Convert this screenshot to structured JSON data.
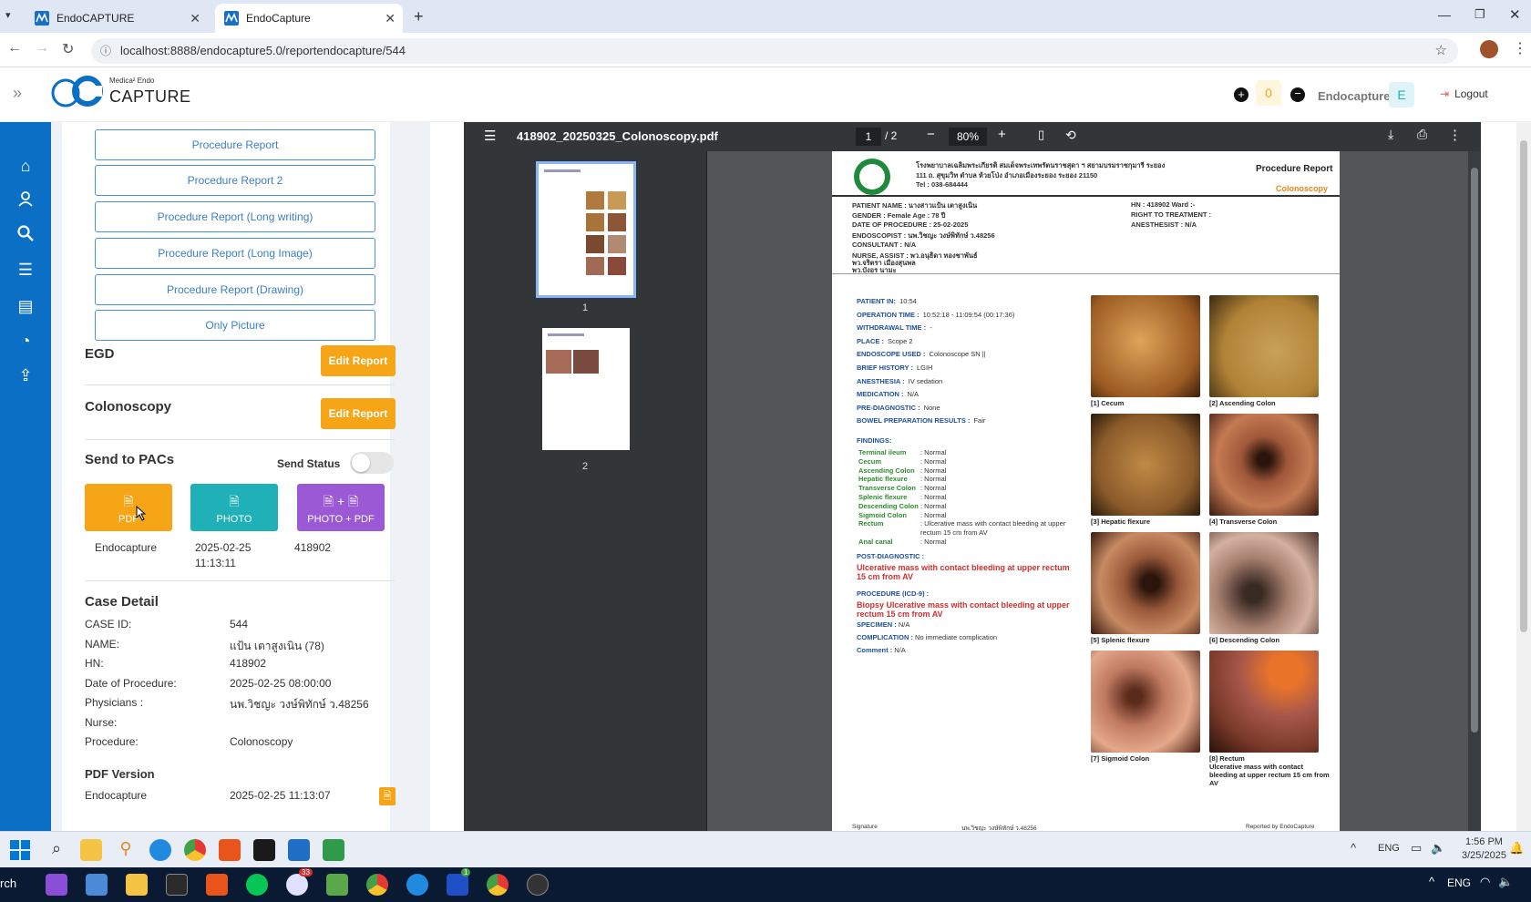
{
  "browser": {
    "tabs": [
      {
        "title": "EndoCAPTURE",
        "active": false
      },
      {
        "title": "EndoCapture",
        "active": true
      }
    ],
    "url": "localhost:8888/endocapture5.0/reportendocapture/544"
  },
  "header": {
    "logo_small": "Medica² Endo",
    "logo_big": "CAPTURE",
    "counter": "0",
    "username": "Endocapture",
    "avatar_letter": "E",
    "logout_label": "Logout"
  },
  "left": {
    "report_buttons": [
      "Procedure Report",
      "Procedure Report 2",
      "Procedure Report (Long writing)",
      "Procedure Report (Long Image)",
      "Procedure Report (Drawing)",
      "Only Picture"
    ],
    "egd_title": "EGD",
    "colonoscopy_title": "Colonoscopy",
    "edit_report_label": "Edit Report",
    "pacs_title": "Send to PACs",
    "send_status_label": "Send Status",
    "pacs_buttons": {
      "pdf": "PDF",
      "photo": "PHOTO",
      "photo_pdf": "PHOTO + PDF"
    },
    "pacs_row": {
      "user": "Endocapture",
      "date": "2025-02-25",
      "time": "11:13:11",
      "hn": "418902"
    },
    "case_title": "Case Detail",
    "case": [
      {
        "k": "CASE ID:",
        "v": "544"
      },
      {
        "k": "NAME:",
        "v": "แป้น เตาสูงเนิน (78)"
      },
      {
        "k": "HN:",
        "v": "418902"
      },
      {
        "k": "Date of Procedure:",
        "v": "2025-02-25 08:00:00"
      },
      {
        "k": "Physicians :",
        "v": "นพ.วิชญะ วงษ์พิทักษ์ ว.48256"
      },
      {
        "k": "Nurse:",
        "v": ""
      },
      {
        "k": "Procedure:",
        "v": "Colonoscopy"
      }
    ],
    "pdf_version_title": "PDF Version",
    "pdf_version_user": "Endocapture",
    "pdf_version_date": "2025-02-25 11:13:07"
  },
  "pdf": {
    "filename": "418902_20250325_Colonoscopy.pdf",
    "page_current": "1",
    "page_total": "/ 2",
    "zoom": "80%",
    "thumb_labels": [
      "1",
      "2"
    ],
    "report": {
      "hospital_line1": "โรงพยาบาลเฉลิมพระเกียรติ สมเด็จพระเทพรัตนราชสุดา ฯ สยามบรมราชกุมารี ระยอง",
      "hospital_line2": "111 ถ. สุขุมวิท ตำบล ห้วยโป่ง อำเภอเมืองระยอง ระยอง 21150",
      "hospital_line3": "Tel : 038-684444",
      "report_title": "Procedure Report",
      "report_subtitle": "Colonoscopy",
      "patient_name": "PATIENT NAME : นางสาวแป้น เตาสูงเนิน",
      "gender": "GENDER : Female    Age : 78  ปี",
      "date_of_procedure": "DATE OF PROCEDURE : 25-02-2025",
      "endoscopist": "ENDOSCOPIST :  นพ.วิชญะ วงษ์พิทักษ์ ว.48256",
      "consultant": "CONSULTANT :  N/A",
      "nurse_assist": "NURSE, ASSIST :  พว.อนุธิดา ทองชาพันธ์",
      "nurse_2": "พว.จริตรา เมืองสุนพล",
      "nurse_3": "พว.บังอร นามะ",
      "hn_ward": "HN : 418902    Ward :-",
      "right_to_treatment": "RIGHT TO TREATMENT :",
      "anesthesist": "ANESTHESIST :  N/A",
      "fields": [
        {
          "k": "PATIENT IN:",
          "v": "10:54"
        },
        {
          "k": "OPERATION TIME :",
          "v": "10:52:18 - 11:09:54 (00:17:36)"
        },
        {
          "k": "WITHDRAWAL TIME :",
          "v": "-"
        },
        {
          "k": "PLACE :",
          "v": "Scope 2"
        },
        {
          "k": "ENDOSCOPE USED :",
          "v": "Colonoscope SN ||"
        },
        {
          "k": "BRIEF HISTORY :",
          "v": "LGIH"
        },
        {
          "k": "ANESTHESIA :",
          "v": "IV sedation"
        },
        {
          "k": "MEDICATION :",
          "v": "N/A"
        },
        {
          "k": "PRE-DIAGNOSTIC :",
          "v": "None"
        },
        {
          "k": "BOWEL PREPARATION RESULTS :",
          "v": "Fair"
        }
      ],
      "findings_title": "FINDINGS:",
      "findings": [
        {
          "k": "Terminal ileum",
          "v": ": Normal"
        },
        {
          "k": "Cecum",
          "v": ": Normal"
        },
        {
          "k": "Ascending Colon",
          "v": ": Normal"
        },
        {
          "k": "Hepatic flexure",
          "v": ": Normal"
        },
        {
          "k": "Transverse Colon",
          "v": ": Normal"
        },
        {
          "k": "Splenic flexure",
          "v": ": Normal"
        },
        {
          "k": "Descending Colon",
          "v": ": Normal"
        },
        {
          "k": "Sigmoid Colon",
          "v": ": Normal"
        },
        {
          "k": "Rectum",
          "v": ": Ulcerative mass with contact bleeding at upper"
        },
        {
          "k": "",
          "v": "rectum 15 cm from AV"
        },
        {
          "k": "Anal canal",
          "v": ": Normal"
        }
      ],
      "post_diag_label": "POST-DIAGNOSTIC :",
      "post_diag_1": "Ulcerative mass with contact bleeding at upper rectum",
      "post_diag_2": "15 cm from AV",
      "procedure_label": "PROCEDURE (ICD-9) :",
      "procedure_1": "Biopsy Ulcerative mass with contact bleeding at upper",
      "procedure_2": "rectum 15 cm from AV",
      "specimen": {
        "k": "SPECIMEN :",
        "v": "N/A"
      },
      "complication": {
        "k": "COMPLICATION :",
        "v": "No immediate complication"
      },
      "comment": {
        "k": "Comment :",
        "v": "N/A"
      },
      "images": [
        {
          "caption": "[1] Cecum"
        },
        {
          "caption": "[2] Ascending Colon"
        },
        {
          "caption": "[3] Hepatic flexure"
        },
        {
          "caption": "[4] Transverse Colon"
        },
        {
          "caption": "[5] Splenic flexure"
        },
        {
          "caption": "[6] Descending Colon"
        },
        {
          "caption": "[7] Sigmoid Colon"
        },
        {
          "caption": "[8] Rectum"
        }
      ],
      "rectum_note_1": "Ulcerative mass with contact",
      "rectum_note_2": "bleeding at upper rectum 15 cm from",
      "rectum_note_3": "AV",
      "signature": "Signature",
      "signature_name": "นพ.วิชญะ วงษ์พิทักษ์ ว.48256",
      "reported_by": "Reported by EndoCapture"
    }
  },
  "taskbar": {
    "lang": "ENG",
    "time": "1:56 PM",
    "date": "3/25/2025",
    "search_fragment": "rch",
    "lang2": "ENG",
    "badge_33": "33",
    "badge_1": "1"
  },
  "colors": {
    "accent_blue": "#0b6fc6",
    "orange": "#f5a515",
    "teal": "#20b1b8",
    "purple": "#9b59d6"
  }
}
